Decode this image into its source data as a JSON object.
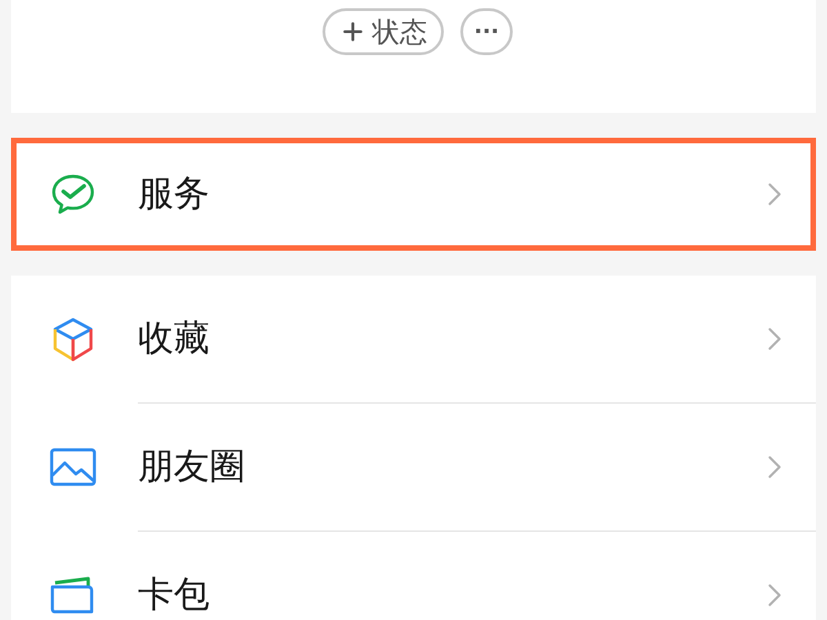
{
  "header": {
    "status_button": "状态",
    "more_button": "···"
  },
  "sections": [
    {
      "items": [
        {
          "label": "服务",
          "kind": "service",
          "highlighted": true
        }
      ]
    },
    {
      "items": [
        {
          "label": "收藏",
          "kind": "favorites",
          "highlighted": false
        },
        {
          "label": "朋友圈",
          "kind": "moments",
          "highlighted": false
        },
        {
          "label": "卡包",
          "kind": "cards",
          "highlighted": false
        }
      ]
    }
  ]
}
